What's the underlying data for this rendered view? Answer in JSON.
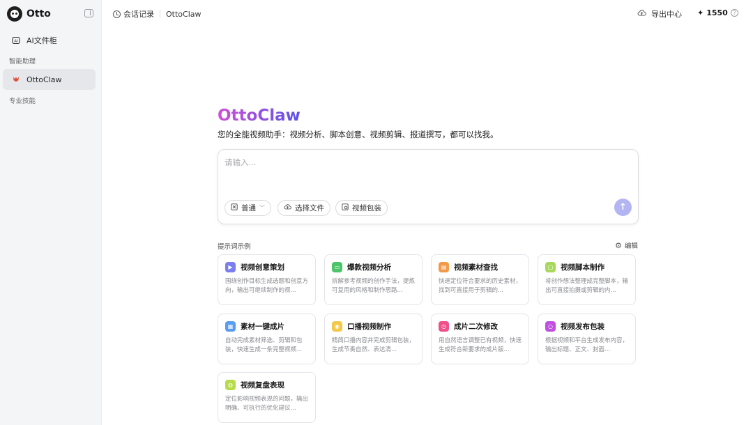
{
  "sidebar": {
    "brand": "Otto",
    "ai_cabinet": "AI文件柜",
    "section_assistants": "智能助理",
    "active_item": "OttoClaw",
    "section_skills": "专业技能"
  },
  "topbar": {
    "history_label": "会话记录",
    "breadcrumb": "OttoClaw",
    "export_label": "导出中心",
    "credits": "1550",
    "help_glyph": "?"
  },
  "hero": {
    "title": "OttoClaw",
    "subtitle": "您的全能视频助手：视频分析、脚本创意、视频剪辑、报道撰写，都可以找我。"
  },
  "composer": {
    "placeholder": "请输入...",
    "mode_label": "普通",
    "file_label": "选择文件",
    "package_label": "视频包装"
  },
  "prompts": {
    "label": "提示词示例",
    "edit_label": "编辑",
    "cards": [
      {
        "title": "视频创意策划",
        "desc": "围绕创作目标生成选题和创意方向，输出可继续制作的视...",
        "color": "#7b7ef0",
        "icon": "play-icon"
      },
      {
        "title": "爆款视频分析",
        "desc": "拆解参考视频的创作手法，提炼可复用的风格和制作思路...",
        "color": "#4cc46a",
        "icon": "screen-icon"
      },
      {
        "title": "视频素材查找",
        "desc": "快速定位符合要求的历史素材，找到可直接用于剪辑的...",
        "color": "#f29a4a",
        "icon": "image-icon"
      },
      {
        "title": "视频脚本制作",
        "desc": "将创作想法整理成完整脚本，输出可直接拍摄或剪辑的内...",
        "color": "#a8d85a",
        "icon": "doc-icon"
      },
      {
        "title": "素材一键成片",
        "desc": "自动完成素材筛选、剪辑和包装，快速生成一条完整视频...",
        "color": "#5a9cf0",
        "icon": "film-icon"
      },
      {
        "title": "口播视频制作",
        "desc": "精简口播内容并完成剪辑包装，生成节奏自然、表达清...",
        "color": "#f2c94a",
        "icon": "mic-icon"
      },
      {
        "title": "成片二次修改",
        "desc": "用自然语言调整已有视频，快速生成符合新要求的成片版...",
        "color": "#f0508a",
        "icon": "timer-icon"
      },
      {
        "title": "视频发布包装",
        "desc": "根据视频和平台生成发布内容，输出标题、正文、封面...",
        "color": "#c150e0",
        "icon": "search-icon"
      },
      {
        "title": "视频复盘表现",
        "desc": "定位影响视频表现的问题，输出明确、可执行的优化建议...",
        "color": "#b6dc4a",
        "icon": "chart-icon"
      }
    ]
  }
}
